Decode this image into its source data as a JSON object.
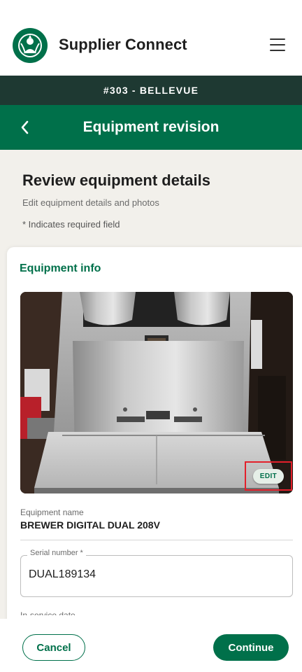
{
  "app": {
    "title": "Supplier Connect",
    "logo_icon": "siren-logo-icon",
    "menu_icon": "hamburger-menu-icon"
  },
  "store": {
    "label": "#303 - BELLEVUE"
  },
  "nav": {
    "title": "Equipment revision",
    "back_icon": "chevron-left-icon"
  },
  "review": {
    "title": "Review equipment details",
    "subtitle": "Edit equipment details and photos",
    "required_note": "* Indicates required field"
  },
  "equipment": {
    "section_title": "Equipment info",
    "photo_edit_label": "EDIT",
    "name_label": "Equipment name",
    "name_value": "BREWER DIGITAL DUAL 208V",
    "serial_label": "Serial number *",
    "serial_value": "DUAL189134",
    "in_service_label": "In-service date"
  },
  "footer": {
    "cancel_label": "Cancel",
    "continue_label": "Continue"
  },
  "colors": {
    "brand_green": "#00704a",
    "dark_green": "#1e3932",
    "background": "#f2f0eb",
    "highlight_red": "#e3202b"
  }
}
